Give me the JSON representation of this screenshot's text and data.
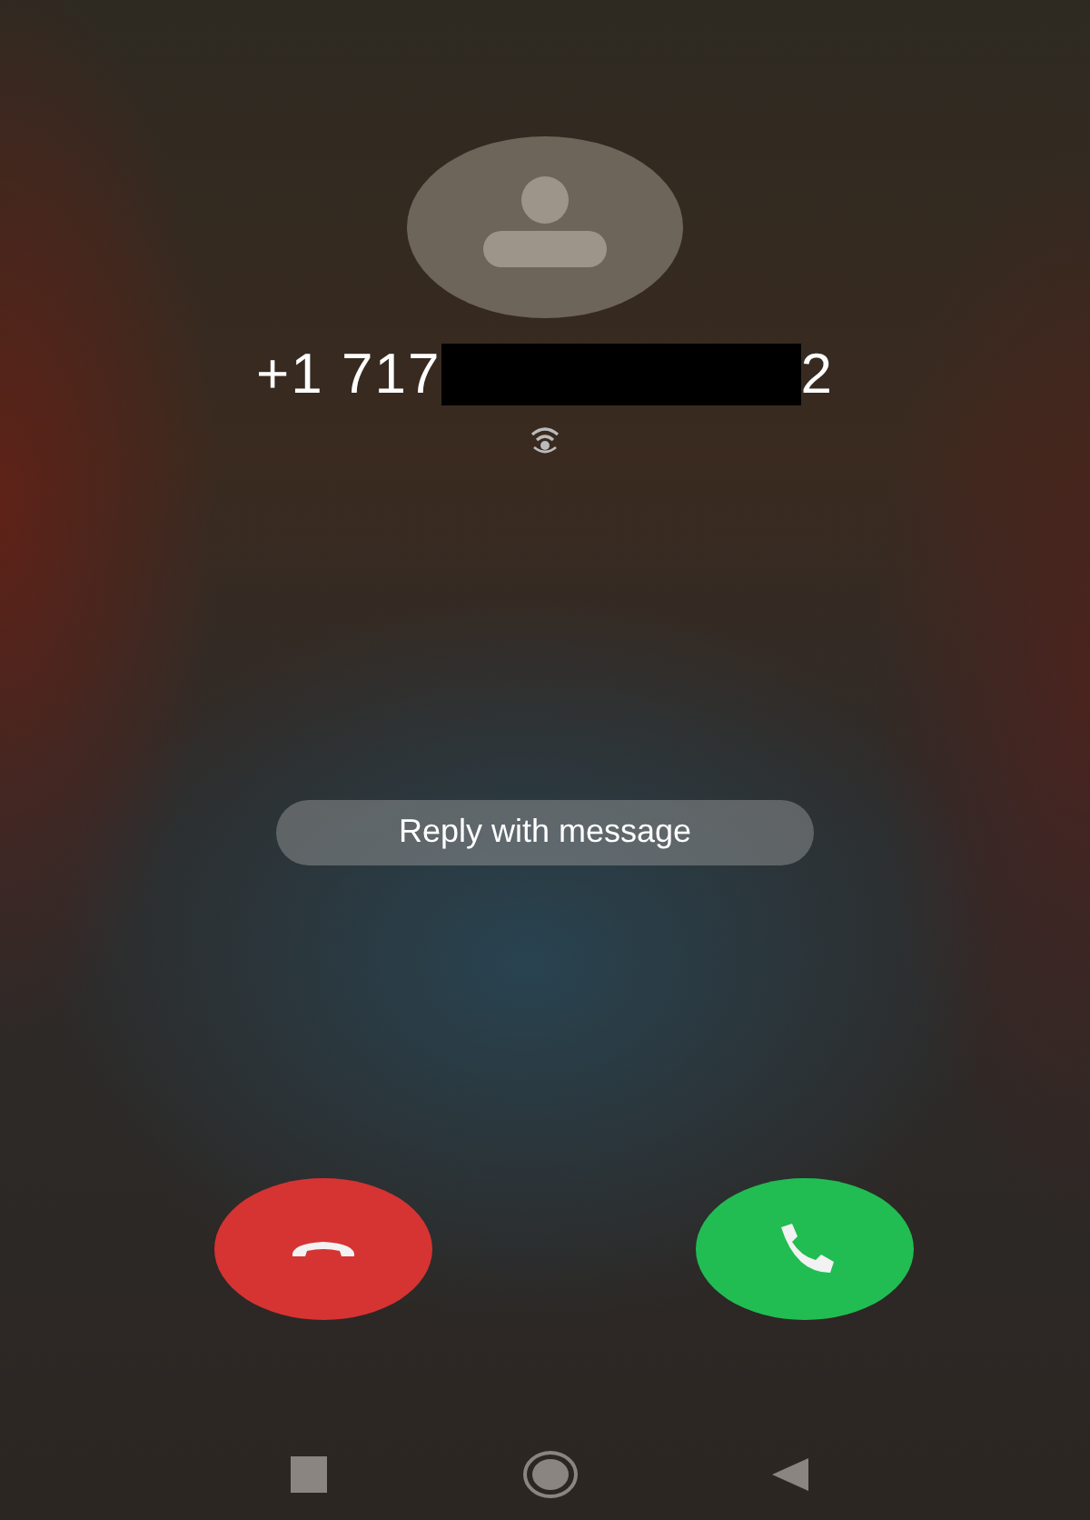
{
  "caller": {
    "number_start": "+1 717",
    "number_end": "2",
    "redacted": true
  },
  "reply_button": {
    "label": "Reply with message"
  },
  "call_buttons": [
    {
      "kind": "decline"
    },
    {
      "kind": "accept"
    }
  ],
  "nav_bar": [
    {
      "kind": "recents"
    },
    {
      "kind": "home"
    },
    {
      "kind": "back"
    }
  ]
}
